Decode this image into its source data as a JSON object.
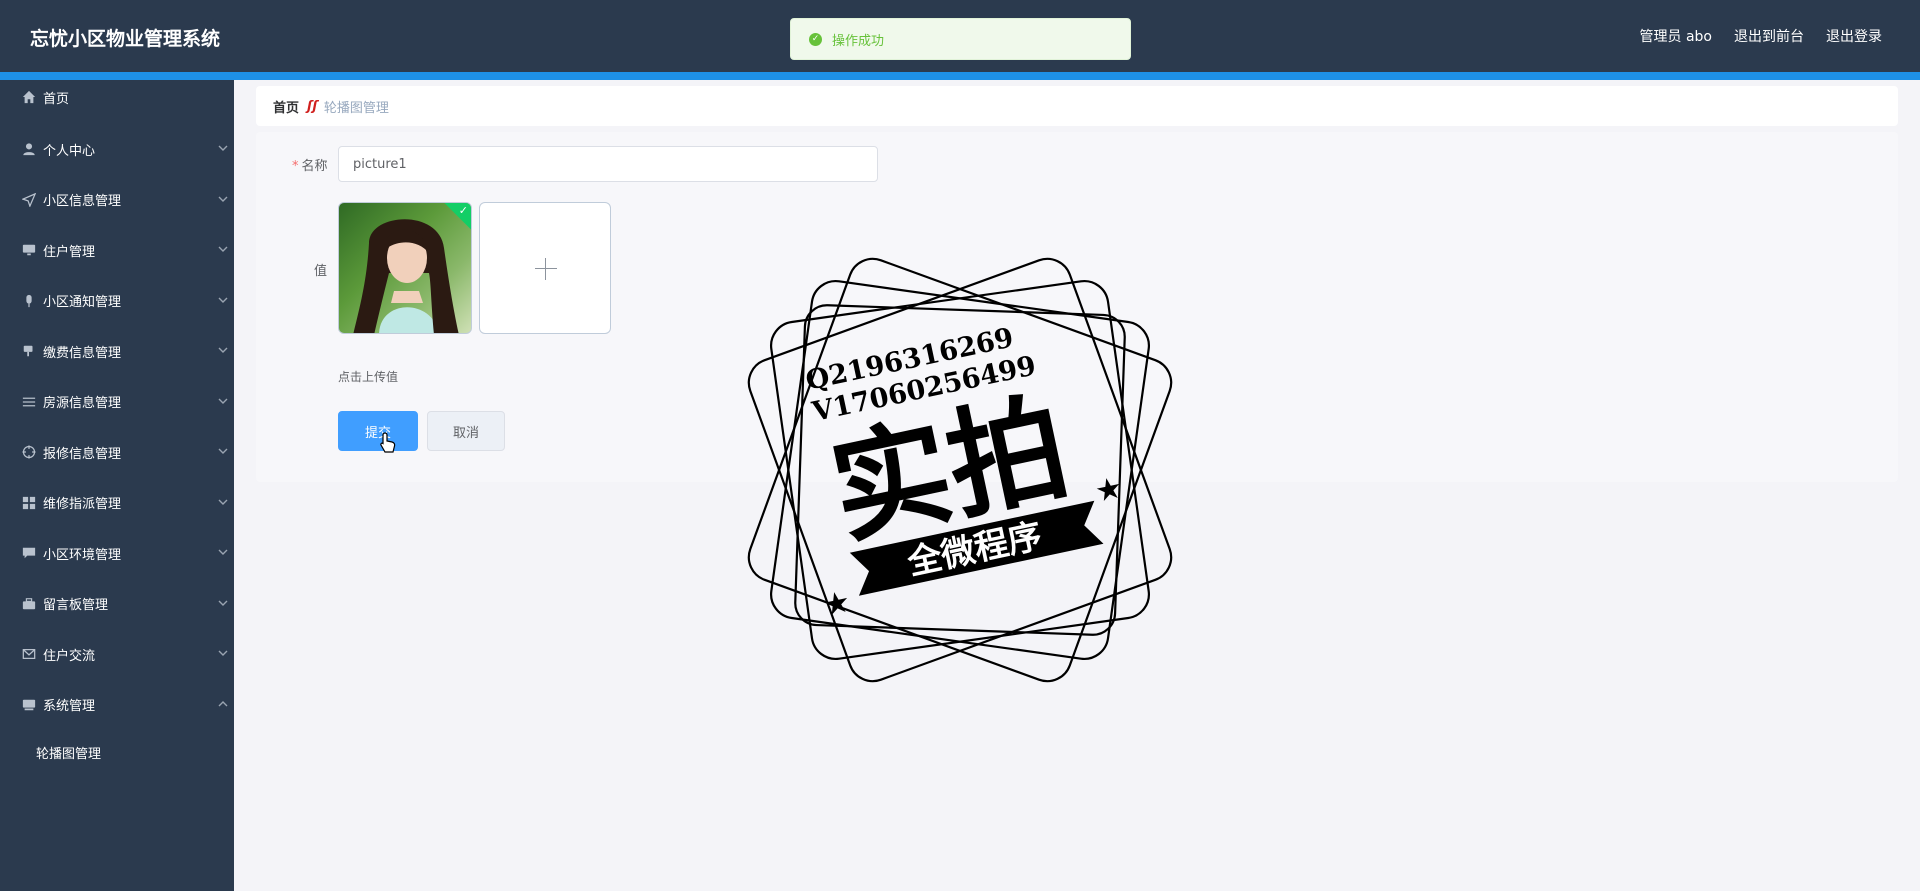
{
  "header": {
    "title": "忘忧小区物业管理系统",
    "admin_label": "管理员 abo",
    "to_front": "退出到前台",
    "logout": "退出登录"
  },
  "toast": {
    "message": "操作成功"
  },
  "sidebar": {
    "items": [
      {
        "label": "首页",
        "icon": "home-icon"
      },
      {
        "label": "个人中心",
        "icon": "user-icon"
      },
      {
        "label": "小区信息管理",
        "icon": "navigation-icon"
      },
      {
        "label": "住户管理",
        "icon": "monitor-icon"
      },
      {
        "label": "小区通知管理",
        "icon": "microphone-icon"
      },
      {
        "label": "缴费信息管理",
        "icon": "coffee-cup-icon"
      },
      {
        "label": "房源信息管理",
        "icon": "list-icon"
      },
      {
        "label": "报修信息管理",
        "icon": "target-icon"
      },
      {
        "label": "维修指派管理",
        "icon": "grid-icon"
      },
      {
        "label": "小区环境管理",
        "icon": "chat-icon"
      },
      {
        "label": "留言板管理",
        "icon": "briefcase-icon"
      },
      {
        "label": "住户交流",
        "icon": "message-icon"
      },
      {
        "label": "系统管理",
        "icon": "monitor-icon"
      }
    ],
    "sub_items": [
      {
        "label": "轮播图管理"
      }
    ]
  },
  "breadcrumb": {
    "home": "首页",
    "current": "轮播图管理"
  },
  "form": {
    "name_label": "名称",
    "name_value": "picture1",
    "value_label": "值",
    "upload_hint": "点击上传值",
    "submit_label": "提交",
    "cancel_label": "取消"
  },
  "watermark": {
    "line1": "Q2196316269",
    "line2": "V17060256499",
    "main": "实拍",
    "ribbon": "全微程序"
  }
}
